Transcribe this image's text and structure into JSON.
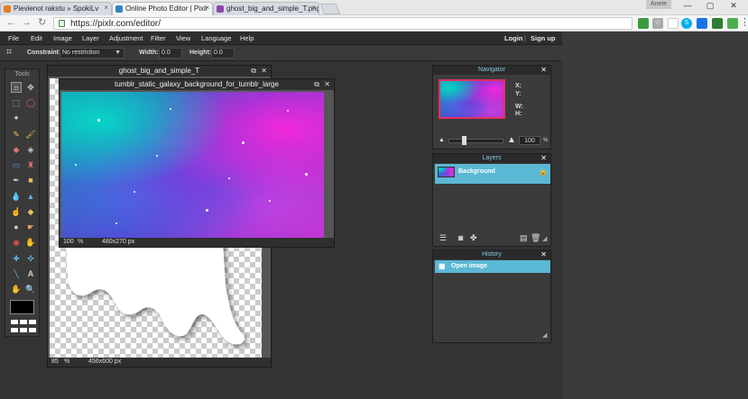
{
  "browser": {
    "tabs": [
      {
        "label": "Pievienot rakstu » SpokiLv",
        "fav_color": "#e67e22"
      },
      {
        "label": "Online Photo Editor | Pixlr",
        "fav_color": "#2e86c1"
      },
      {
        "label": "ghost_big_and_simple_T.png",
        "fav_color": "#8e44ad"
      }
    ],
    "user": "Anete",
    "window_controls": {
      "minimize": "—",
      "maximize": "▢",
      "close": "✕"
    },
    "url": "https://pixlr.com/editor/",
    "nav": {
      "back": "←",
      "forward": "→",
      "reload": "↻"
    }
  },
  "menubar": {
    "items": [
      "File",
      "Edit",
      "Image",
      "Layer",
      "Adjustment",
      "Filter",
      "View",
      "Language",
      "Help"
    ],
    "login": "Login",
    "separator": "|",
    "signup": "Sign up"
  },
  "options": {
    "constraint_label": "Constraint:",
    "constraint_value": "No restriction",
    "width_label": "Width:",
    "width_value": "0.0",
    "height_label": "Height:",
    "height_value": "0.0"
  },
  "tools": {
    "title": "Tools"
  },
  "doc_ghost": {
    "title": "ghost_big_and_simple_T",
    "zoom": "85",
    "zoom_unit": "%",
    "size": "456x600 px"
  },
  "doc_galaxy": {
    "title": "tumblr_static_galaxy_background_for_tumblr_large",
    "zoom": "100",
    "zoom_unit": "%",
    "size": "480x270 px"
  },
  "navigator": {
    "title": "Navigator",
    "x_label": "X:",
    "y_label": "Y:",
    "w_label": "W:",
    "h_label": "H:",
    "zoom_value": "100",
    "zoom_unit": "%"
  },
  "layers": {
    "title": "Layers",
    "items": [
      {
        "name": "Background"
      }
    ]
  },
  "history": {
    "title": "History",
    "items": [
      {
        "name": "Open image"
      }
    ]
  },
  "colors": {
    "accent": "#5bb8d4",
    "panel_bg": "#3b3b3b",
    "menubar_bg": "#2d2d2d"
  }
}
